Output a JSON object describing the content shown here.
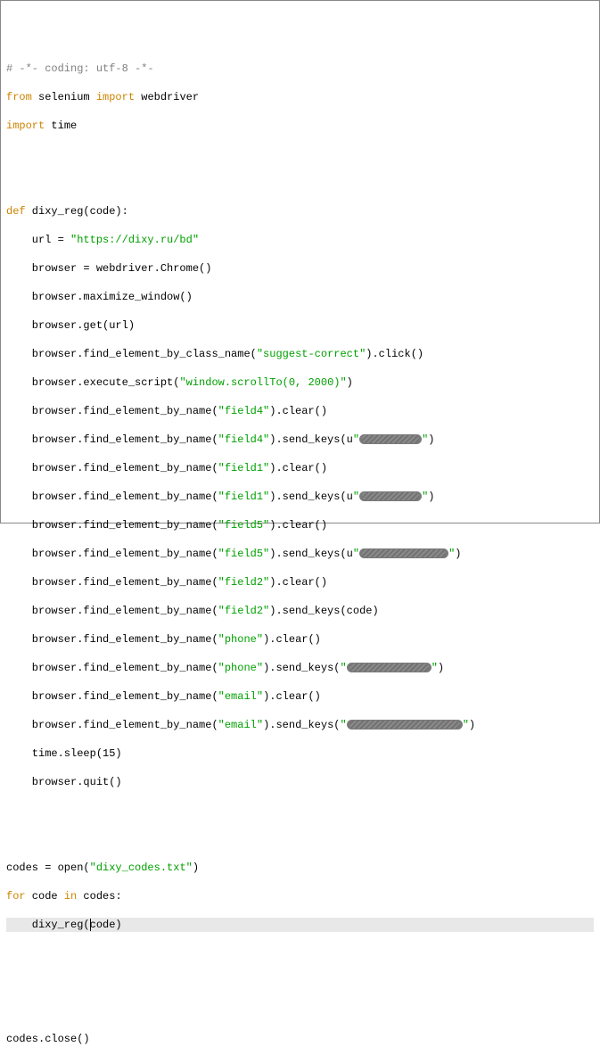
{
  "code": {
    "l1_comment": "# -*- coding: utf-8 -*-",
    "l2_kw1": "from",
    "l2_name1": " selenium ",
    "l2_kw2": "import",
    "l2_name2": " webdriver",
    "l3_kw": "import",
    "l3_name": " time",
    "l6_kw": "def",
    "l6_name": " dixy_reg(code):",
    "l7_name": "    url = ",
    "l7_str": "\"https://dixy.ru/bd\"",
    "l8": "    browser = webdriver.Chrome()",
    "l9": "    browser.maximize_window()",
    "l10": "    browser.get(url)",
    "l11a": "    browser.find_element_by_class_name(",
    "l11s": "\"suggest-correct\"",
    "l11b": ").click()",
    "l12a": "    browser.execute_script(",
    "l12s": "\"window.scrollTo(0, 2000)\"",
    "l12b": ")",
    "l13a": "    browser.find_element_by_name(",
    "l13s": "\"field4\"",
    "l13b": ").clear()",
    "l14a": "    browser.find_element_by_name(",
    "l14s": "\"field4\"",
    "l14b": ").send_keys(u",
    "l14q1": "\"",
    "l14q2": "\"",
    "l14c": ")",
    "l15a": "    browser.find_element_by_name(",
    "l15s": "\"field1\"",
    "l15b": ").clear()",
    "l16a": "    browser.find_element_by_name(",
    "l16s": "\"field1\"",
    "l16b": ").send_keys(u",
    "l16q1": "\"",
    "l16q2": "\"",
    "l16c": ")",
    "l17a": "    browser.find_element_by_name(",
    "l17s": "\"field5\"",
    "l17b": ").clear()",
    "l18a": "    browser.find_element_by_name(",
    "l18s": "\"field5\"",
    "l18b": ").send_keys(u",
    "l18q1": "\"",
    "l18q2": "\"",
    "l18c": ")",
    "l19a": "    browser.find_element_by_name(",
    "l19s": "\"field2\"",
    "l19b": ").clear()",
    "l20a": "    browser.find_element_by_name(",
    "l20s": "\"field2\"",
    "l20b": ").send_keys(code)",
    "l21a": "    browser.find_element_by_name(",
    "l21s": "\"phone\"",
    "l21b": ").clear()",
    "l22a": "    browser.find_element_by_name(",
    "l22s": "\"phone\"",
    "l22b": ").send_keys(",
    "l22q1": "\"",
    "l22q2": "\"",
    "l22c": ")",
    "l23a": "    browser.find_element_by_name(",
    "l23s": "\"email\"",
    "l23b": ").clear()",
    "l24a": "    browser.find_element_by_name(",
    "l24s": "\"email\"",
    "l24b": ").send_keys(",
    "l24q1": "\"",
    "l24q2": "\"",
    "l24c": ")",
    "l25": "    time.sleep(15)",
    "l26": "    browser.quit()",
    "l29a": "codes = open(",
    "l29s": "\"dixy_codes.txt\"",
    "l29b": ")",
    "l30k1": "for",
    "l30n1": " code ",
    "l30k2": "in",
    "l30n2": " codes:",
    "l31": "    dixy_reg(code)",
    "l35": "codes.close()"
  },
  "redact_widths": {
    "r14": 70,
    "r16": 70,
    "r18": 100,
    "r22": 95,
    "r24": 130
  }
}
